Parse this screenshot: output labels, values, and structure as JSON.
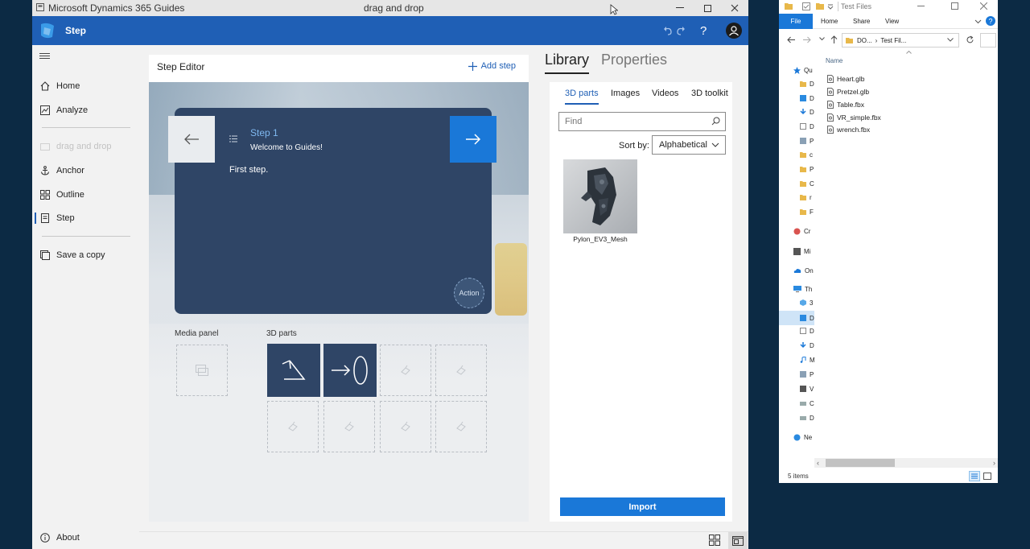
{
  "guides": {
    "titlebar": {
      "app_title": "Microsoft Dynamics 365 Guides",
      "document": "drag and drop"
    },
    "header": {
      "title": "Step"
    },
    "nav": [
      {
        "label": "Home",
        "icon": "home-icon"
      },
      {
        "label": "Analyze",
        "icon": "analyze-icon"
      },
      {
        "label": "drag and drop",
        "icon": "guide-icon"
      },
      {
        "label": "Anchor",
        "icon": "anchor-icon"
      },
      {
        "label": "Outline",
        "icon": "outline-icon"
      },
      {
        "label": "Step",
        "icon": "step-icon"
      },
      {
        "label": "Save a copy",
        "icon": "save-copy-icon"
      },
      {
        "label": "About",
        "icon": "info-icon"
      }
    ],
    "editor": {
      "title": "Step Editor",
      "add_step": "Add step",
      "step_name": "Step 1",
      "step_subtitle": "Welcome to Guides!",
      "step_body": "First step.",
      "action_label": "Action",
      "media_panel_label": "Media panel",
      "parts_label": "3D parts"
    },
    "library": {
      "tab_library": "Library",
      "tab_properties": "Properties",
      "subtabs": [
        "3D parts",
        "Images",
        "Videos",
        "3D toolkit"
      ],
      "find_placeholder": "Find",
      "sort_label": "Sort by:",
      "sort_value": "Alphabetical",
      "items": [
        {
          "name": "Pylon_EV3_Mesh"
        }
      ],
      "import_button": "Import"
    }
  },
  "explorer": {
    "title": "Test Files",
    "ribbon": {
      "file": "File",
      "tabs": [
        "Home",
        "Share",
        "View"
      ]
    },
    "path": [
      "DO...",
      "Test Fil..."
    ],
    "column_name": "Name",
    "files": [
      "Heart.glb",
      "Pretzel.glb",
      "Table.fbx",
      "VR_simple.fbx",
      "wrench.fbx"
    ],
    "sidebar": [
      "Qu",
      "D",
      "D",
      "D",
      "D",
      "P",
      "c",
      "P",
      "C",
      "r",
      "F",
      "Cr",
      "Mi",
      "On",
      "Th",
      "3",
      "D",
      "D",
      "D",
      "M",
      "P",
      "V",
      "C",
      "D",
      "Ne"
    ],
    "status": "5 items"
  },
  "colors": {
    "accent": "#1f5fb5",
    "button_blue": "#1a78d8",
    "card": "#2f4566"
  }
}
